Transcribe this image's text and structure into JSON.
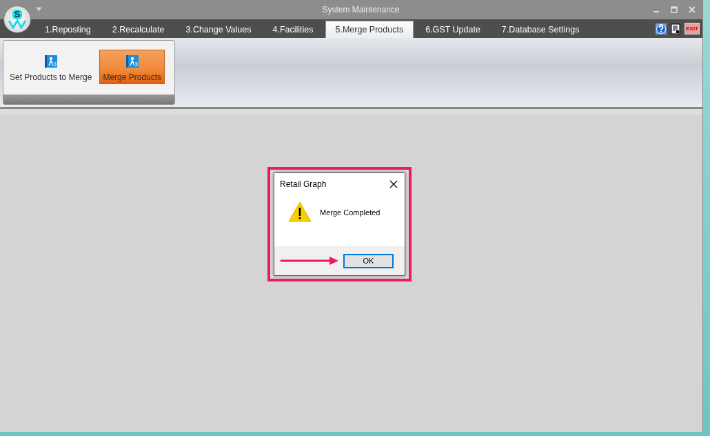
{
  "window": {
    "title": "System Maintenance",
    "logo_letter": "S"
  },
  "tabs": [
    {
      "label": "1.Reposting",
      "selected": false
    },
    {
      "label": "2.Recalculate",
      "selected": false
    },
    {
      "label": "3.Change Values",
      "selected": false
    },
    {
      "label": "4.Facilities",
      "selected": false
    },
    {
      "label": "5.Merge Products",
      "selected": true
    },
    {
      "label": "6.GST Update",
      "selected": false
    },
    {
      "label": "7.Database Settings",
      "selected": false
    }
  ],
  "exit_label": "EXIT",
  "ribbon": [
    {
      "label": "Set Products to Merge",
      "selected": false
    },
    {
      "label": "Merge Products",
      "selected": true
    }
  ],
  "dialog": {
    "title": "Retail Graph",
    "message": "Merge Completed",
    "button": "OK"
  }
}
